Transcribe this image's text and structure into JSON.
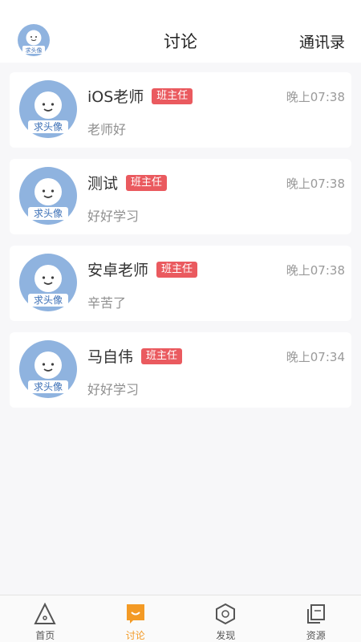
{
  "header": {
    "title": "讨论",
    "contacts_label": "通讯录",
    "avatar_text": "求头像"
  },
  "conversations": [
    {
      "name": "iOS老师",
      "badge": "班主任",
      "time": "晚上07:38",
      "message": "老师好",
      "avatar_text": "求头像"
    },
    {
      "name": "测试",
      "badge": "班主任",
      "time": "晚上07:38",
      "message": "好好学习",
      "avatar_text": "求头像"
    },
    {
      "name": "安卓老师",
      "badge": "班主任",
      "time": "晚上07:38",
      "message": "辛苦了",
      "avatar_text": "求头像"
    },
    {
      "name": "马自伟",
      "badge": "班主任",
      "time": "晚上07:34",
      "message": "好好学习",
      "avatar_text": "求头像"
    }
  ],
  "tabbar": {
    "items": [
      {
        "label": "首页",
        "icon": "home-triangle-icon"
      },
      {
        "label": "讨论",
        "icon": "chat-bubble-icon",
        "active": true
      },
      {
        "label": "发现",
        "icon": "discover-hexagon-icon"
      },
      {
        "label": "资源",
        "icon": "resources-stack-icon"
      }
    ]
  },
  "colors": {
    "accent": "#f39a25",
    "badge": "#ea5a5f",
    "avatar_bg": "#8fb3df"
  }
}
